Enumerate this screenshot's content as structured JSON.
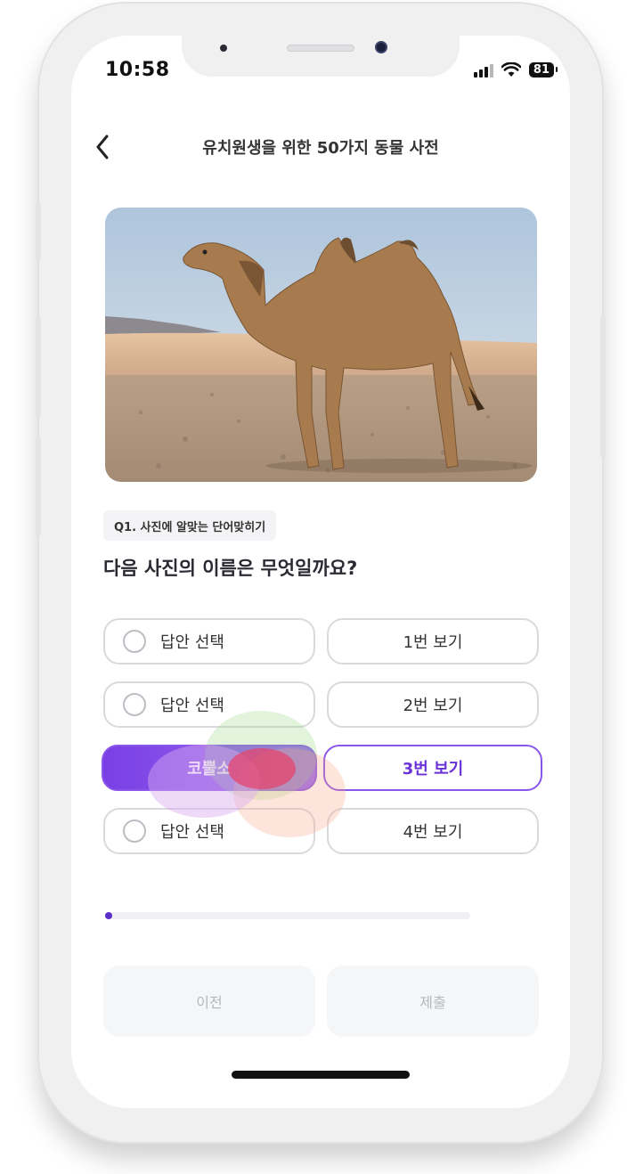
{
  "status": {
    "time": "10:58",
    "battery": "81"
  },
  "nav": {
    "title": "유치원생을 위한 50가지 동물 사전"
  },
  "question": {
    "chip": "Q1. 사진에 알맞는 단어맞히기",
    "text": "다음 사진의 이름은 무엇일까요?"
  },
  "choices": [
    {
      "answer": "답안 선택",
      "option": "1번 보기"
    },
    {
      "answer": "답안 선택",
      "option": "2번 보기"
    },
    {
      "answer": "코뿔소",
      "option": "3번 보기"
    },
    {
      "answer": "답안 선택",
      "option": "4번 보기"
    }
  ],
  "progress": {
    "fraction": 0.01
  },
  "buttons": {
    "prev": "이전",
    "submit": "제출"
  },
  "colors": {
    "accent": "#8a55ea",
    "accent_dark": "#5a2ec9",
    "text": "#333333"
  }
}
